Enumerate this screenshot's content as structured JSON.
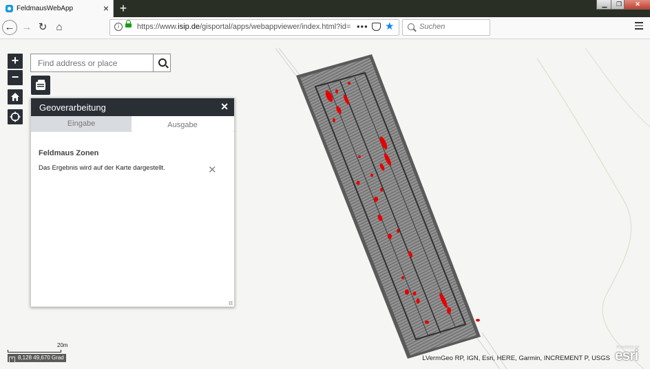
{
  "browser": {
    "tab_title": "FeldmausWebApp",
    "url_prefix": "https://www.",
    "url_domain": "isip.de",
    "url_path": "/gisportal/apps/webappviewer/index.html?id=",
    "search_placeholder": "Suchen"
  },
  "map": {
    "search_placeholder": "Find address or place",
    "scale_label": "20m",
    "coordinates": "8,128 49,670 Grad",
    "attribution": "LVermGeo RP, IGN, Esri, HERE, Garmin, INCREMENT P, USGS",
    "logo_powered": "POWERED BY",
    "logo_text": "esri"
  },
  "panel": {
    "title": "Geoverarbeitung",
    "tabs": [
      "Eingabe",
      "Ausgabe"
    ],
    "active_tab": "Ausgabe",
    "result_title": "Feldmaus Zonen",
    "result_message": "Das Ergebnis wird auf der Karte dargestellt."
  },
  "colors": {
    "panel_header": "#2a2f36",
    "zone_fill": "#e60000",
    "field_gray": "#8a8a8a"
  },
  "icons": [
    "zoom-in-icon",
    "zoom-out-icon",
    "home-icon",
    "locate-icon",
    "geoprocessing-icon",
    "search-icon",
    "close-icon"
  ]
}
